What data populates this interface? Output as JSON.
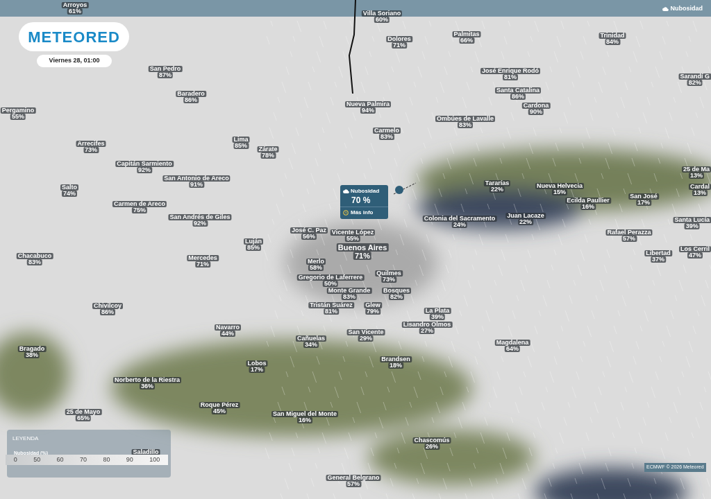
{
  "header": {
    "logo": "METEORED",
    "datetime": "Viernes 28, 01:00",
    "layer_button": "Nubosidad"
  },
  "places": [
    {
      "name": "Arroyos",
      "value": "61%"
    },
    {
      "name": "Villa Soriano",
      "value": "60%"
    },
    {
      "name": "Palmitas",
      "value": "66%"
    },
    {
      "name": "Trinidad",
      "value": "84%"
    },
    {
      "name": "Dolores",
      "value": "71%"
    },
    {
      "name": "San Pedro",
      "value": "87%"
    },
    {
      "name": "José Enrique Rodó",
      "value": "81%"
    },
    {
      "name": "Sarandí G",
      "value": "82%"
    },
    {
      "name": "Baradero",
      "value": "86%"
    },
    {
      "name": "Santa Catalina",
      "value": "86%"
    },
    {
      "name": "Nueva Palmira",
      "value": "94%"
    },
    {
      "name": "Cardona",
      "value": "90%"
    },
    {
      "name": "Pergamino",
      "value": "55%"
    },
    {
      "name": "Ombúes de Lavalle",
      "value": "83%"
    },
    {
      "name": "Carmelo",
      "value": "83%"
    },
    {
      "name": "Lima",
      "value": "85%"
    },
    {
      "name": "Arrecifes",
      "value": "73%"
    },
    {
      "name": "Zárate",
      "value": "78%"
    },
    {
      "name": "Capitán Sarmiento",
      "value": "92%"
    },
    {
      "name": "25 de Ma",
      "value": "13%"
    },
    {
      "name": "San Antonio de Areco",
      "value": "91%"
    },
    {
      "name": "Salto",
      "value": "74%"
    },
    {
      "name": "Tararías",
      "value": "22%"
    },
    {
      "name": "Nueva Helvecia",
      "value": "15%"
    },
    {
      "name": "Cardal",
      "value": "13%"
    },
    {
      "name": "Carmen de Areco",
      "value": "75%"
    },
    {
      "name": "San José",
      "value": "17%"
    },
    {
      "name": "Ecilda Paullier",
      "value": "16%"
    },
    {
      "name": "San Andrés de Giles",
      "value": "92%"
    },
    {
      "name": "Colonia del Sacramento",
      "value": "24%"
    },
    {
      "name": "Juan Lacaze",
      "value": "22%"
    },
    {
      "name": "Santa Lucía",
      "value": "39%"
    },
    {
      "name": "José C. Paz",
      "value": "56%"
    },
    {
      "name": "Vicente López",
      "value": "55%"
    },
    {
      "name": "Rafael Perazza",
      "value": "57%"
    },
    {
      "name": "Luján",
      "value": "85%"
    },
    {
      "name": "Chacabuco",
      "value": "83%"
    },
    {
      "name": "Mercedes",
      "value": "71%"
    },
    {
      "name": "Merlo",
      "value": "58%"
    },
    {
      "name": "Buenos Aires",
      "value": "71%"
    },
    {
      "name": "Libertad",
      "value": "37%"
    },
    {
      "name": "Los Cerril",
      "value": "47%"
    },
    {
      "name": "Quilmes",
      "value": "73%"
    },
    {
      "name": "Gregorio de Laferrere",
      "value": "50%"
    },
    {
      "name": "Monte Grande",
      "value": "83%"
    },
    {
      "name": "Bosques",
      "value": "82%"
    },
    {
      "name": "Chivilcoy",
      "value": "86%"
    },
    {
      "name": "Tristán Suárez",
      "value": "81%"
    },
    {
      "name": "Glew",
      "value": "79%"
    },
    {
      "name": "La Plata",
      "value": "39%"
    },
    {
      "name": "Navarro",
      "value": "44%"
    },
    {
      "name": "Cañuelas",
      "value": "34%"
    },
    {
      "name": "San Vicente",
      "value": "29%"
    },
    {
      "name": "Lisandro Olmos",
      "value": "27%"
    },
    {
      "name": "Magdalena",
      "value": "64%"
    },
    {
      "name": "Bragado",
      "value": "38%"
    },
    {
      "name": "Brandsen",
      "value": "18%"
    },
    {
      "name": "Lobos",
      "value": "17%"
    },
    {
      "name": "Norberto de la Riestra",
      "value": "36%"
    },
    {
      "name": "Roque Pérez",
      "value": "45%"
    },
    {
      "name": "25 de Mayo",
      "value": "65%"
    },
    {
      "name": "San Miguel del Monte",
      "value": "16%"
    },
    {
      "name": "Chascomús",
      "value": "26%"
    },
    {
      "name": "General Belgrano",
      "value": "57%"
    }
  ],
  "popup": {
    "title": "Nubosidad",
    "value": "70 %",
    "link": "Más info"
  },
  "legend": {
    "title": "LEYENDA",
    "label": "Nubosidad (%)",
    "hidden_place": "Saladillo",
    "ticks": [
      "0",
      "50",
      "60",
      "70",
      "80",
      "90",
      "100"
    ]
  },
  "attribution": "ECMWF © 2026 Meteored"
}
